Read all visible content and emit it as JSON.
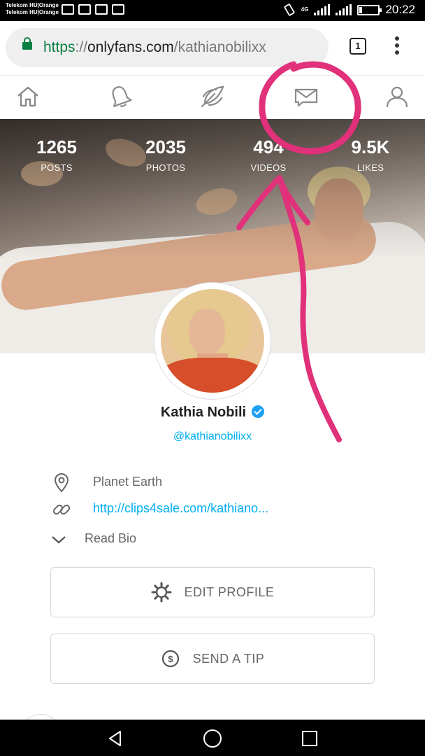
{
  "status_bar": {
    "carrier_1": "Telekom HU|Orange",
    "carrier_2": "Telekom HU|Orange",
    "network": "4G",
    "time": "20:22",
    "battery_level": 0.15
  },
  "browser": {
    "url_scheme": "https",
    "url_sep": "://",
    "url_host": "onlyfans.com",
    "url_path": "/kathianobilixx",
    "tab_count": "1"
  },
  "app_nav": {
    "items": [
      {
        "name": "home",
        "icon": "home-icon"
      },
      {
        "name": "notifications",
        "icon": "bell-icon"
      },
      {
        "name": "new-post",
        "icon": "feather-icon"
      },
      {
        "name": "messages",
        "icon": "envelope-icon"
      },
      {
        "name": "profile",
        "icon": "user-icon"
      }
    ]
  },
  "stats": [
    {
      "value": "1265",
      "label": "POSTS"
    },
    {
      "value": "2035",
      "label": "PHOTOS"
    },
    {
      "value": "494",
      "label": "VIDEOS"
    },
    {
      "value": "9.5K",
      "label": "LIKES"
    }
  ],
  "profile": {
    "name": "Kathia Nobili",
    "handle": "@kathianobilixx",
    "location": "Planet Earth",
    "website": "http://clips4sale.com/kathiano...",
    "read_bio": "Read Bio"
  },
  "buttons": {
    "edit_profile": "EDIT PROFILE",
    "send_tip": "SEND A TIP"
  },
  "colors": {
    "accent": "#00aff0",
    "secure_green": "#0b8043",
    "annotation_pink": "#e0317a",
    "verified_blue": "#1da1f2"
  }
}
